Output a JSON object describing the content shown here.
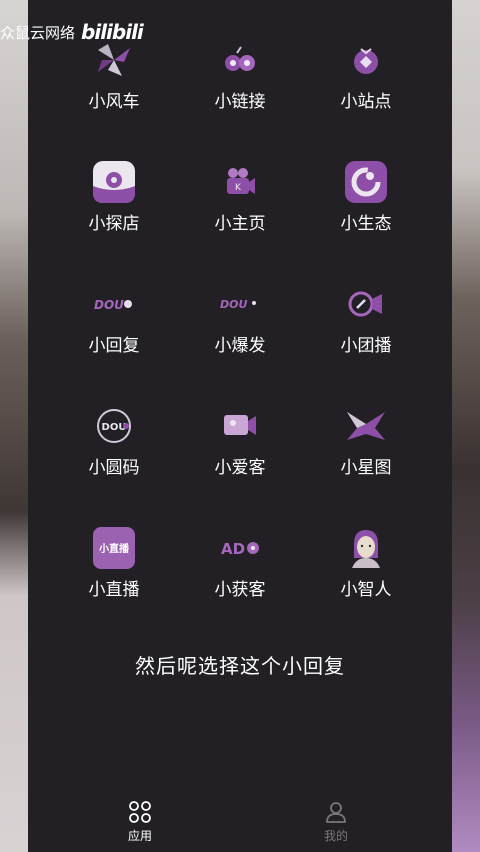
{
  "watermark": {
    "text": "众鼠云网络",
    "brand": "bilibili"
  },
  "apps": [
    {
      "label": "小风车",
      "icon": "windmill-icon"
    },
    {
      "label": "小链接",
      "icon": "link-icon"
    },
    {
      "label": "小站点",
      "icon": "site-icon"
    },
    {
      "label": "小探店",
      "icon": "explore-shop-icon"
    },
    {
      "label": "小主页",
      "icon": "homepage-camera-icon"
    },
    {
      "label": "小生态",
      "icon": "ecology-icon"
    },
    {
      "label": "小回复",
      "icon": "reply-icon",
      "logo_text": "DOU"
    },
    {
      "label": "小爆发",
      "icon": "burst-icon",
      "logo_text": "DOU"
    },
    {
      "label": "小团播",
      "icon": "group-live-icon"
    },
    {
      "label": "小圆码",
      "icon": "round-code-icon",
      "logo_text": "DOU"
    },
    {
      "label": "小爱客",
      "icon": "love-customer-icon"
    },
    {
      "label": "小星图",
      "icon": "star-map-icon"
    },
    {
      "label": "小直播",
      "icon": "live-stream-icon",
      "logo_text": "小直播"
    },
    {
      "label": "小获客",
      "icon": "acquire-customer-icon",
      "logo_text": "AD"
    },
    {
      "label": "小智人",
      "icon": "smart-person-icon"
    }
  ],
  "caption": "然后呢选择这个小回复",
  "tabbar": {
    "apps_label": "应用",
    "mine_label": "我的"
  },
  "colors": {
    "accent": "#8e4fa8",
    "panel": "#222024",
    "text": "#ffffff"
  }
}
